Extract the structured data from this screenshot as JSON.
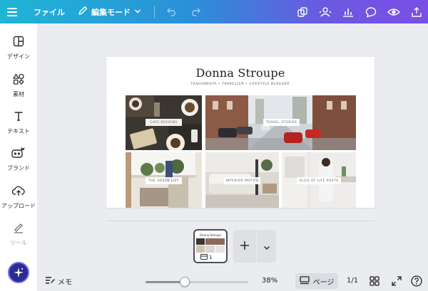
{
  "topbar": {
    "menu_icon": "hamburger-icon",
    "file_label": "ファイル",
    "edit_mode_label": "編集モード",
    "icons": [
      "pencil-icon",
      "chevron-down-icon",
      "undo-icon",
      "redo-icon",
      "duplicate-icon",
      "collaborate-icon",
      "insights-icon",
      "comment-icon",
      "preview-icon",
      "share-icon"
    ]
  },
  "sidebar": {
    "items": [
      {
        "label": "デザイン",
        "icon": "design-icon"
      },
      {
        "label": "素材",
        "icon": "elements-icon"
      },
      {
        "label": "テキスト",
        "icon": "text-icon"
      },
      {
        "label": "ブランド",
        "icon": "brand-icon"
      },
      {
        "label": "アップロード",
        "icon": "upload-icon"
      },
      {
        "label": "ツール",
        "icon": "tools-icon"
      }
    ],
    "assistant_icon": "magic-sparkle-icon"
  },
  "design": {
    "title": "Donna Stroupe",
    "subtitle": "FASHIONISTA • TRAVELLER • LIFESTYLE BLOGGER",
    "tiles": [
      {
        "caption": "CAFE REVIEWS"
      },
      {
        "caption": "TRAVEL STORIES"
      },
      {
        "caption": "THE GREEN LIST"
      },
      {
        "caption": "INTERIOR MOTIFS"
      },
      {
        "caption": "SLICE OF LIFE POSTS"
      }
    ]
  },
  "pages": {
    "thumb_title": "Donna Stroupe",
    "thumb_number": "1",
    "add_icon": "plus-icon",
    "more_icon": "chevron-down-icon"
  },
  "bottombar": {
    "memo_label": "メモ",
    "zoom_value": "38%",
    "zoom_fraction": 0.38,
    "pages_label": "ページ",
    "page_count": "1/1",
    "icons": [
      "notes-icon",
      "pages-view-icon",
      "grid-view-icon",
      "fullscreen-icon",
      "help-icon"
    ]
  },
  "colors": {
    "topbar_start": "#1fb6d6",
    "topbar_end": "#7a4ee6",
    "workspace_bg": "#ebecf0"
  }
}
